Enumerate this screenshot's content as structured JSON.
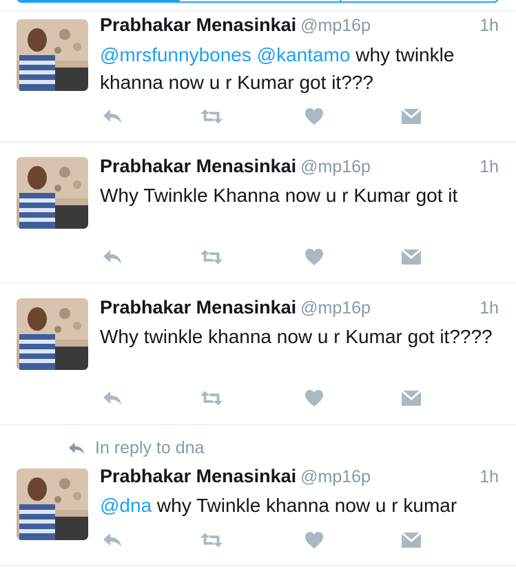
{
  "colors": {
    "accent": "#1da1f2",
    "muted": "#8899a6",
    "text": "#14171a",
    "separator": "#e1e8ed"
  },
  "tweets": [
    {
      "name": "Prabhakar Menasinkai",
      "handle": "@mp16p",
      "time": "1h",
      "mention1": "@mrsfunnybones",
      "mention2": "@kantamo",
      "text_rest": " why twinkle khanna now u r Kumar got it???"
    },
    {
      "name": "Prabhakar Menasinkai",
      "handle": "@mp16p",
      "time": "1h",
      "text": "Why Twinkle Khanna now u r Kumar got it"
    },
    {
      "name": "Prabhakar Menasinkai",
      "handle": "@mp16p",
      "time": "1h",
      "text": "Why twinkle khanna now u r Kumar got it????"
    },
    {
      "reply_context": "In reply to dna",
      "name": "Prabhakar Menasinkai",
      "handle": "@mp16p",
      "time": "1h",
      "mention1": "@dna",
      "text_rest": " why Twinkle khanna now u r kumar"
    }
  ],
  "icons": [
    "reply-icon",
    "retweet-icon",
    "like-icon",
    "direct-message-icon",
    "avatar-image"
  ]
}
